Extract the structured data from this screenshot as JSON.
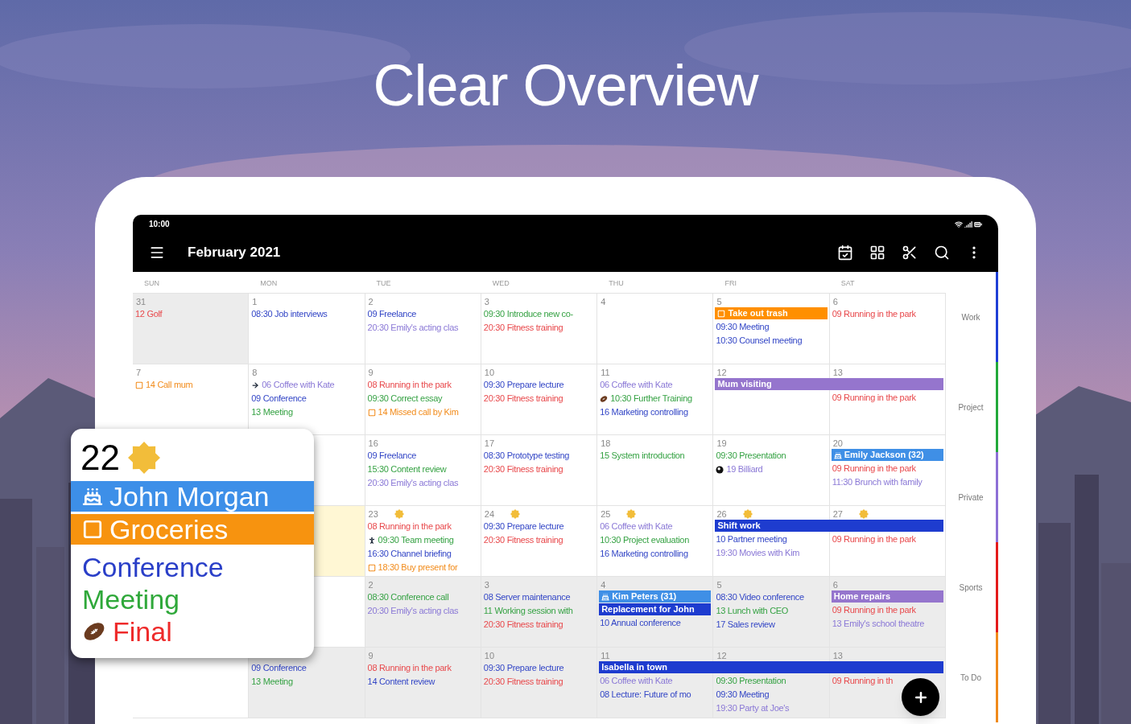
{
  "headline": "Clear Overview",
  "status_bar": {
    "time": "10:00"
  },
  "app_bar": {
    "title": "February 2021"
  },
  "weekdays": [
    "SUN",
    "MON",
    "TUE",
    "WED",
    "THU",
    "FRI",
    "SAT"
  ],
  "weeks": [
    {
      "cells": [
        {
          "day": "31",
          "muted": true,
          "events": [
            {
              "kind": "text",
              "text": "12 Golf",
              "color": "#e8484b"
            }
          ]
        },
        {
          "day": "1",
          "events": [
            {
              "kind": "text",
              "text": "08:30 Job interviews",
              "color": "#3346c6"
            }
          ]
        },
        {
          "day": "2",
          "events": [
            {
              "kind": "text",
              "text": "09 Freelance",
              "color": "#3346c6"
            },
            {
              "kind": "text",
              "text": "20:30 Emily's acting clas",
              "color": "#8a78d6"
            }
          ]
        },
        {
          "day": "3",
          "events": [
            {
              "kind": "text",
              "text": "09:30 Introduce new co-",
              "color": "#36a244"
            },
            {
              "kind": "text",
              "text": "20:30 Fitness training",
              "color": "#e8484b"
            }
          ]
        },
        {
          "day": "4"
        },
        {
          "day": "5",
          "bars": [
            {
              "kind": "todo",
              "label": "Take out trash",
              "color": "#ff8f00"
            }
          ],
          "events": [
            {
              "kind": "text",
              "text": "09:30 Meeting",
              "color": "#3346c6"
            },
            {
              "kind": "text",
              "text": "10:30 Counsel meeting",
              "color": "#3346c6"
            }
          ]
        },
        {
          "day": "6",
          "events": [
            {
              "kind": "text",
              "text": "09 Running in the park",
              "color": "#e8484b"
            }
          ]
        }
      ]
    },
    {
      "cells": [
        {
          "day": "7",
          "events": [
            {
              "kind": "todo",
              "text": "14 Call mum",
              "color": "#f28c1c"
            }
          ]
        },
        {
          "day": "8",
          "events": [
            {
              "kind": "arrow",
              "text": "06 Coffee with Kate",
              "color": "#8a78d6"
            },
            {
              "kind": "text",
              "text": "09 Conference",
              "color": "#3346c6"
            },
            {
              "kind": "text",
              "text": "13 Meeting",
              "color": "#36a244"
            }
          ]
        },
        {
          "day": "9",
          "events": [
            {
              "kind": "text",
              "text": "08 Running in the park",
              "color": "#e8484b"
            },
            {
              "kind": "text",
              "text": "09:30 Correct essay",
              "color": "#36a244"
            },
            {
              "kind": "todo",
              "text": "14 Missed call by Kim",
              "color": "#f28c1c"
            }
          ]
        },
        {
          "day": "10",
          "events": [
            {
              "kind": "text",
              "text": "09:30 Prepare lecture",
              "color": "#3346c6"
            },
            {
              "kind": "text",
              "text": "20:30 Fitness training",
              "color": "#e8484b"
            }
          ]
        },
        {
          "day": "11",
          "events": [
            {
              "kind": "text",
              "text": "06 Coffee with Kate",
              "color": "#8a78d6"
            },
            {
              "kind": "sport",
              "text": "10:30 Further Training",
              "color": "#36a244"
            },
            {
              "kind": "text",
              "text": "16 Marketing controlling",
              "color": "#3346c6"
            }
          ]
        },
        {
          "day": "12",
          "bars": [
            {
              "kind": "plain",
              "label": "Mum visiting",
              "color": "#9575cd"
            }
          ]
        },
        {
          "day": "13",
          "bars": [
            {
              "continued": true
            }
          ],
          "events": [
            {
              "kind": "text",
              "text": "09 Running in the park",
              "color": "#e8484b"
            }
          ]
        }
      ]
    },
    {
      "cells": [
        {},
        {},
        {
          "day": "16",
          "events": [
            {
              "kind": "text",
              "text": "09 Freelance",
              "color": "#3346c6"
            },
            {
              "kind": "text",
              "text": "15:30 Content review",
              "color": "#36a244"
            },
            {
              "kind": "text",
              "text": "20:30 Emily's acting clas",
              "color": "#8a78d6"
            }
          ]
        },
        {
          "day": "17",
          "events": [
            {
              "kind": "text",
              "text": "08:30 Prototype testing",
              "color": "#3346c6"
            },
            {
              "kind": "text",
              "text": "20:30 Fitness training",
              "color": "#e8484b"
            }
          ]
        },
        {
          "day": "18",
          "events": [
            {
              "kind": "text",
              "text": "15 System introduction",
              "color": "#36a244"
            }
          ]
        },
        {
          "day": "19",
          "events": [
            {
              "kind": "text",
              "text": "09:30 Presentation",
              "color": "#36a244"
            },
            {
              "kind": "billiard",
              "text": "19 Billiard",
              "color": "#8a78d6"
            }
          ]
        },
        {
          "day": "20",
          "bars": [
            {
              "kind": "birthday",
              "label": "Emily Jackson (32)",
              "color": "#3f8fe6"
            }
          ],
          "events": [
            {
              "kind": "text",
              "text": "09 Running in the park",
              "color": "#e8484b"
            },
            {
              "kind": "text",
              "text": "11:30 Brunch with family",
              "color": "#8a78d6"
            }
          ]
        }
      ]
    },
    {
      "cells": [
        {},
        {
          "today": true
        },
        {
          "day": "23",
          "sunny": true,
          "events": [
            {
              "kind": "text",
              "text": "08 Running in the park",
              "color": "#e8484b"
            },
            {
              "kind": "runner",
              "text": "09:30 Team meeting",
              "color": "#36a244"
            },
            {
              "kind": "text",
              "text": "16:30 Channel briefing",
              "color": "#3346c6"
            },
            {
              "kind": "todo",
              "text": "18:30 Buy present for",
              "color": "#f28c1c"
            }
          ]
        },
        {
          "day": "24",
          "sunny": true,
          "events": [
            {
              "kind": "text",
              "text": "09:30 Prepare lecture",
              "color": "#3346c6"
            },
            {
              "kind": "text",
              "text": "20:30 Fitness training",
              "color": "#e8484b"
            }
          ]
        },
        {
          "day": "25",
          "sunny": true,
          "events": [
            {
              "kind": "text",
              "text": "06 Coffee with Kate",
              "color": "#8a78d6"
            },
            {
              "kind": "text",
              "text": "10:30 Project evaluation",
              "color": "#36a244"
            },
            {
              "kind": "text",
              "text": "16 Marketing controlling",
              "color": "#3346c6"
            }
          ]
        },
        {
          "day": "26",
          "sunny": true,
          "bars": [
            {
              "kind": "plain",
              "label": "Shift work",
              "color": "#1e3ccf"
            }
          ],
          "events": [
            {
              "kind": "text",
              "text": "10 Partner meeting",
              "color": "#3346c6"
            },
            {
              "kind": "text",
              "text": "19:30 Movies with Kim",
              "color": "#8a78d6"
            }
          ]
        },
        {
          "day": "27",
          "sunny": true,
          "bars": [
            {
              "continued": true
            }
          ],
          "events": [
            {
              "kind": "text",
              "text": "09 Running in the park",
              "color": "#e8484b"
            }
          ]
        }
      ]
    },
    {
      "cells": [
        {},
        {},
        {
          "day": "2",
          "muted": true,
          "events": [
            {
              "kind": "text",
              "text": "08:30 Conference call",
              "color": "#36a244"
            },
            {
              "kind": "text",
              "text": "20:30 Emily's acting clas",
              "color": "#8a78d6"
            }
          ]
        },
        {
          "day": "3",
          "muted": true,
          "events": [
            {
              "kind": "text",
              "text": "08 Server maintenance",
              "color": "#3346c6"
            },
            {
              "kind": "text",
              "text": "11 Working session with",
              "color": "#36a244"
            },
            {
              "kind": "text",
              "text": "20:30 Fitness training",
              "color": "#e8484b"
            }
          ]
        },
        {
          "day": "4",
          "muted": true,
          "bars": [
            {
              "kind": "birthday",
              "label": "Kim Peters (31)",
              "color": "#3f8fe6"
            },
            {
              "kind": "plain",
              "label": "Replacement for John",
              "color": "#1e3ccf"
            }
          ],
          "events": [
            {
              "kind": "text",
              "text": "10 Annual conference",
              "color": "#3346c6"
            }
          ]
        },
        {
          "day": "5",
          "muted": true,
          "events": [
            {
              "kind": "text",
              "text": "08:30 Video conference",
              "color": "#3346c6"
            },
            {
              "kind": "text",
              "text": "13 Lunch with CEO",
              "color": "#36a244"
            },
            {
              "kind": "text",
              "text": "17 Sales review",
              "color": "#3346c6"
            }
          ]
        },
        {
          "day": "6",
          "muted": true,
          "bars": [
            {
              "kind": "plain",
              "label": "Home repairs",
              "color": "#9575cd"
            }
          ],
          "events": [
            {
              "kind": "text",
              "text": "09 Running in the park",
              "color": "#e8484b"
            },
            {
              "kind": "text",
              "text": "13 Emily's school theatre",
              "color": "#8a78d6"
            }
          ]
        }
      ]
    },
    {
      "cells": [
        {},
        {
          "muted": true,
          "events": [
            {
              "kind": "text",
              "text": "09 Conference",
              "color": "#3346c6"
            },
            {
              "kind": "text",
              "text": "13 Meeting",
              "color": "#36a244"
            }
          ]
        },
        {
          "day": "9",
          "muted": true,
          "events": [
            {
              "kind": "text",
              "text": "08 Running in the park",
              "color": "#e8484b"
            },
            {
              "kind": "text",
              "text": "14 Content review",
              "color": "#3346c6"
            }
          ]
        },
        {
          "day": "10",
          "muted": true,
          "events": [
            {
              "kind": "text",
              "text": "09:30 Prepare lecture",
              "color": "#3346c6"
            },
            {
              "kind": "text",
              "text": "20:30 Fitness training",
              "color": "#e8484b"
            }
          ]
        },
        {
          "day": "11",
          "muted": true,
          "bars": [
            {
              "kind": "plain",
              "label": "Isabella in town",
              "color": "#1e3ccf"
            }
          ],
          "events": [
            {
              "kind": "text",
              "text": "06 Coffee with Kate",
              "color": "#8a78d6"
            },
            {
              "kind": "text",
              "text": "08 Lecture: Future of mo",
              "color": "#3346c6"
            }
          ]
        },
        {
          "day": "12",
          "muted": true,
          "bars": [
            {
              "continued": true
            }
          ],
          "events": [
            {
              "kind": "text",
              "text": "09:30 Presentation",
              "color": "#36a244"
            },
            {
              "kind": "text",
              "text": "09:30 Meeting",
              "color": "#3346c6"
            },
            {
              "kind": "text",
              "text": "19:30 Party at Joe's",
              "color": "#8a78d6"
            }
          ]
        },
        {
          "day": "13",
          "muted": true,
          "bars": [
            {
              "continued": true
            }
          ],
          "events": [
            {
              "kind": "text",
              "text": "09 Running in th",
              "color": "#e8484b"
            }
          ]
        }
      ]
    }
  ],
  "categories": [
    {
      "label": "Work",
      "color": "#1f3fd6"
    },
    {
      "label": "Project",
      "color": "#22a93a"
    },
    {
      "label": "Private",
      "color": "#8d6fd6"
    },
    {
      "label": "Sports",
      "color": "#e41b1b"
    },
    {
      "label": "To Do",
      "color": "#f08a1a"
    }
  ],
  "zoom_card": {
    "day": "22",
    "sunny": true,
    "items": [
      {
        "kind": "birthday",
        "label": "John Morgan",
        "color": "#3d8fe8"
      },
      {
        "kind": "todo",
        "label": "Groceries",
        "color": "#f7930f"
      },
      {
        "kind": "text",
        "label": "Conference",
        "color": "#2a3fc8"
      },
      {
        "kind": "text",
        "label": "Meeting",
        "color": "#2fa83a"
      },
      {
        "kind": "sport",
        "label": "Final",
        "color": "#ee2a2a"
      }
    ]
  }
}
